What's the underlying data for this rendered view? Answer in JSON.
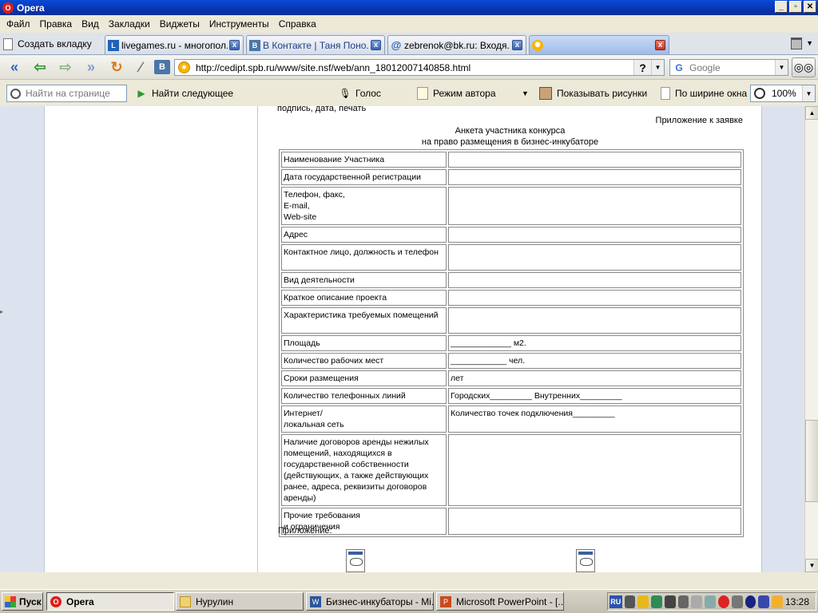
{
  "window": {
    "title": "Opera"
  },
  "menu": [
    "Файл",
    "Правка",
    "Вид",
    "Закладки",
    "Виджеты",
    "Инструменты",
    "Справка"
  ],
  "tabs": {
    "new_tab_label": "Создать вкладку",
    "items": [
      {
        "label": "livegames.ru - многопол...",
        "icon": "livegames-favicon",
        "active": false
      },
      {
        "label": "В Контакте | Таня Поно...",
        "icon": "vkontakte-favicon",
        "active": false
      },
      {
        "label": "zebrenok@bk.ru: Входя...",
        "icon": "at-mail-icon",
        "active": false
      },
      {
        "label": "",
        "icon": "site-favicon",
        "active": true
      }
    ]
  },
  "address": {
    "url": "http://cedipt.spb.ru/www/site.nsf/web/ann_18012007140858.html",
    "search_placeholder": "Google"
  },
  "findbar": {
    "find_placeholder": "Найти на странице",
    "find_next": "Найти следующее",
    "voice": "Голос",
    "author_mode": "Режим автора",
    "show_images": "Показывать рисунки",
    "fit_width": "По ширине окна",
    "zoom": "100%"
  },
  "page": {
    "cut_line": "подпись, дата, печать",
    "annex": "Приложение к заявке",
    "form_title_1": "Анкета участника конкурса",
    "form_title_2": "на право размещения в бизнес-инкубаторе",
    "rows": [
      {
        "label": "Наименование Участника",
        "value": ""
      },
      {
        "label": "Дата государственной регистрации",
        "value": ""
      },
      {
        "label": "Телефон, факс,\nE-mail,\nWeb-site",
        "value": ""
      },
      {
        "label": "Адрес",
        "value": ""
      },
      {
        "label": "Контактное лицо, должность и телефон",
        "value": ""
      },
      {
        "label": "Вид деятельности",
        "value": ""
      },
      {
        "label": "Краткое описание проекта",
        "value": ""
      },
      {
        "label": "Характеристика требуемых помещений",
        "value": ""
      },
      {
        "label": "Площадь",
        "value": "_____________ м2."
      },
      {
        "label": "Количество рабочих мест",
        "value": "____________ чел."
      },
      {
        "label": "Сроки размещения",
        "value": "лет"
      },
      {
        "label": "Количество телефонных линий",
        "value": "Городских_________ Внутренних_________"
      },
      {
        "label": "Интернет/\nлокальная сеть",
        "value": "Количество точек подключения_________"
      },
      {
        "label": "Наличие договоров аренды нежилых помещений, находящихся в государственной собственности (действующих, а также действующих ранее, адреса, реквизиты договоров аренды)",
        "value": ""
      },
      {
        "label": "Прочие требования\nи ограничения",
        "value": ""
      }
    ],
    "appendix": "Приложение:"
  },
  "taskbar": {
    "start": "Пуск",
    "items": [
      {
        "label": "Opera",
        "active": true
      },
      {
        "label": "Нурулин",
        "active": false
      },
      {
        "label": "Бизнес-инкубаторы - Mi...",
        "active": false
      },
      {
        "label": "Microsoft PowerPoint - [...",
        "active": false
      }
    ],
    "lang": "RU",
    "clock": "13:28"
  },
  "colors": {
    "titlebar": "#0a4bd6",
    "side_bands": "#dce3ee",
    "active_tab": "#9dbbe8"
  }
}
